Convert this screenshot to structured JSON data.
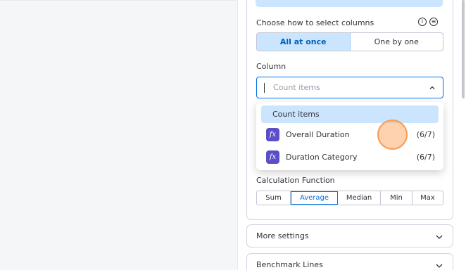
{
  "select_mode": {
    "label": "Choose how to select columns",
    "options": [
      "All at once",
      "One by one"
    ],
    "selected": "All at once"
  },
  "column": {
    "label": "Column",
    "placeholder": "Count items",
    "options": [
      {
        "label": "Count items",
        "highlighted": true
      },
      {
        "label": "Overall Duration",
        "count": "(6/7)",
        "icon": "formula-icon"
      },
      {
        "label": "Duration Category",
        "count": "(6/7)",
        "icon": "formula-icon"
      }
    ]
  },
  "calculation": {
    "label": "Calculation Function",
    "options": [
      "Sum",
      "Average",
      "Median",
      "Min",
      "Max"
    ],
    "selected": "Average"
  },
  "sections": {
    "more_settings": "More settings",
    "benchmark_lines": "Benchmark Lines"
  },
  "icons": {
    "info": "info-icon",
    "help": "feedback-icon",
    "fx_glyph": "fx"
  },
  "colors": {
    "accent": "#0073ea",
    "selected_bg": "#cce5ff",
    "formula_icon": "#5a4ec9"
  }
}
